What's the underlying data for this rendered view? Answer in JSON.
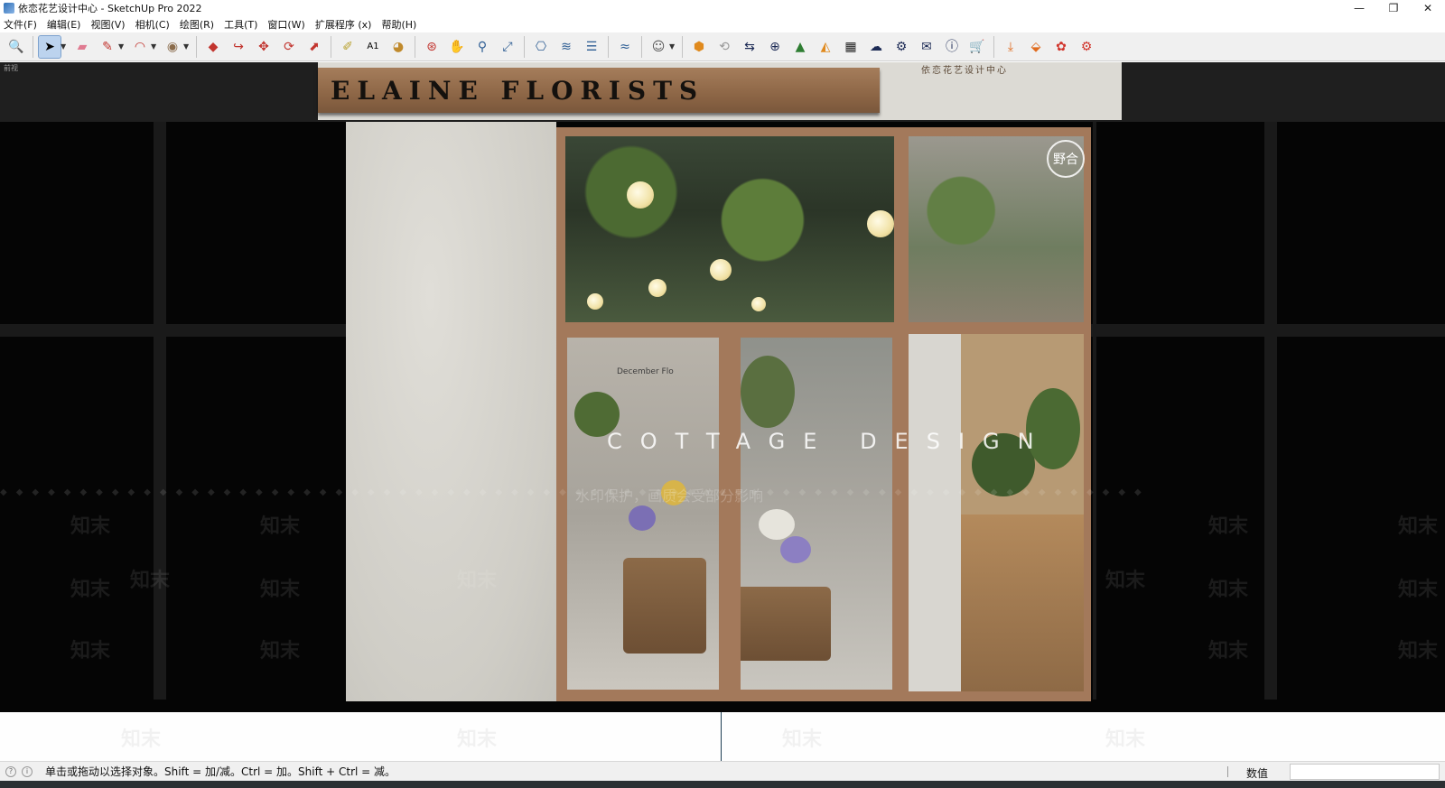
{
  "window": {
    "title": "依恋花艺设计中心 - SketchUp Pro 2022",
    "controls": [
      "—",
      "❐",
      "✕"
    ]
  },
  "menu": [
    "文件(F)",
    "编辑(E)",
    "视图(V)",
    "相机(C)",
    "绘图(R)",
    "工具(T)",
    "窗口(W)",
    "扩展程序 (x)",
    "帮助(H)"
  ],
  "toolbar": {
    "groups": [
      [
        "zoom-icon"
      ],
      [
        "select-icon",
        "eraser-icon",
        "pencil-icon",
        "arc-icon",
        "shape-icon"
      ],
      [
        "push-pull-icon",
        "follow-me-icon",
        "move-icon",
        "rotate-icon",
        "scale-icon"
      ],
      [
        "tape-measure-icon",
        "text-icon",
        "paint-bucket-icon"
      ],
      [
        "orbit-icon",
        "pan-icon",
        "zoom-tool-icon",
        "zoom-extents-icon"
      ],
      [
        "geo-location-icon",
        "sandbox-icon",
        "layers-icon"
      ],
      [
        "sandbox-tools-icon"
      ],
      [
        "account-icon"
      ],
      [
        "extension-warehouse-icon",
        "sync-icon",
        "export-icon",
        "add-icon",
        "tree-icon",
        "terrain-icon",
        "checker-icon",
        "cloud-upload-icon",
        "settings-icon",
        "mail-icon",
        "info-icon",
        "cart-icon",
        "import-icon",
        "layer-up-icon",
        "plugin-icon",
        "gear-plugin-icon"
      ]
    ]
  },
  "viewport": {
    "label": "前视",
    "sign_text": "ELAINE FLORISTS",
    "top_sign_text": "依恋花艺设计中心",
    "overlay_text": "COTTAGE DESIGN",
    "glass_small_text": "December Flo",
    "badge_text": "野合",
    "watermark": "知末",
    "watermark_notice": "水印保护，画质会受部分影响"
  },
  "status": {
    "hint": "单击或拖动以选择对象。Shift = 加/减。Ctrl = 加。Shift + Ctrl = 减。",
    "measurements_label": "数值",
    "measurements_value": ""
  }
}
